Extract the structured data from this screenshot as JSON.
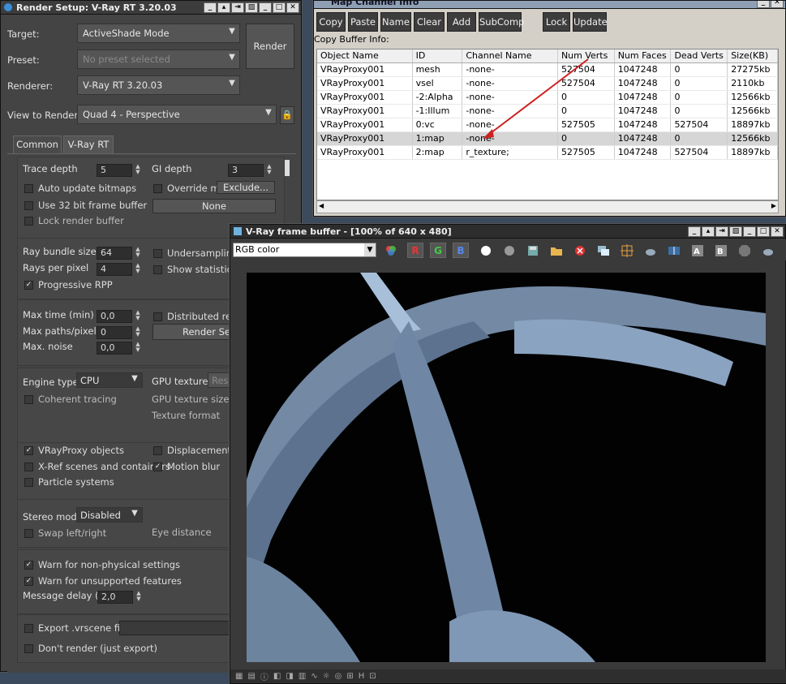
{
  "render_setup": {
    "title": "Render Setup: V-Ray RT 3.20.03",
    "target_label": "Target:",
    "target_value": "ActiveShade Mode",
    "preset_label": "Preset:",
    "preset_value": "No preset selected",
    "renderer_label": "Renderer:",
    "renderer_value": "V-Ray RT 3.20.03",
    "view_label": "View to Render:",
    "view_value": "Quad 4 - Perspective",
    "render_button": "Render",
    "tabs": [
      "Common",
      "V-Ray RT"
    ],
    "trace_depth_label": "Trace depth",
    "trace_depth": "5",
    "gi_depth_label": "GI depth",
    "gi_depth": "3",
    "auto_update": "Auto update bitmaps",
    "override_mtl": "Override mtl",
    "exclude_btn": "Exclude...",
    "use32": "Use 32 bit frame buffer",
    "none_btn": "None",
    "lock_render_buffer": "Lock render buffer",
    "ray_bundle_label": "Ray bundle size",
    "ray_bundle": "64",
    "undersampling": "Undersampling",
    "rays_per_pixel_label": "Rays per pixel",
    "rays_per_pixel": "4",
    "show_statistics": "Show statistics",
    "progressive_rpp": "Progressive RPP",
    "max_time_label": "Max time (min)",
    "max_time": "0,0",
    "distributed": "Distributed rend",
    "max_paths_label": "Max paths/pixel",
    "max_paths": "0",
    "render_serv_btn": "Render Serv",
    "max_noise_label": "Max. noise",
    "max_noise": "0,0",
    "engine_type_label": "Engine type",
    "engine_type": "CPU",
    "gpu_textures_label": "GPU textures",
    "gpu_textures_value": "Resiz",
    "coherent_tracing": "Coherent tracing",
    "gpu_texture_size": "GPU texture size",
    "texture_format": "Texture format",
    "vrayproxy": "VRayProxy objects",
    "displacement": "Displacement",
    "xref": "X-Ref scenes and containers",
    "motion_blur": "Motion blur",
    "particle_systems": "Particle systems",
    "stereo_mode_label": "Stereo mode",
    "stereo_mode": "Disabled",
    "swap_lr": "Swap left/right",
    "eye_distance": "Eye distance",
    "warn_nonphys": "Warn for non-physical settings",
    "warn_unsupported": "Warn for unsupported features",
    "msg_delay_label": "Message delay (s)",
    "msg_delay": "2,0",
    "export_vrscene": "Export .vrscene file",
    "dont_render": "Don't render (just export)"
  },
  "map_channel": {
    "title": "Map Channel Info",
    "buttons": [
      "Copy",
      "Paste",
      "Name",
      "Clear",
      "Add",
      "SubComp",
      "Lock",
      "Update"
    ],
    "copy_buffer": "Copy Buffer Info:",
    "columns": [
      "Object Name",
      "ID",
      "Channel Name",
      "Num Verts",
      "Num Faces",
      "Dead Verts",
      "Size(KB)"
    ],
    "rows": [
      [
        "VRayProxy001",
        "mesh",
        "-none-",
        "527504",
        "1047248",
        "0",
        "27275kb"
      ],
      [
        "VRayProxy001",
        "vsel",
        "-none-",
        "527504",
        "1047248",
        "0",
        "2110kb"
      ],
      [
        "VRayProxy001",
        "-2:Alpha",
        "-none-",
        "0",
        "1047248",
        "0",
        "12566kb"
      ],
      [
        "VRayProxy001",
        "-1:Illum",
        "-none-",
        "0",
        "1047248",
        "0",
        "12566kb"
      ],
      [
        "VRayProxy001",
        "0:vc",
        "-none-",
        "527505",
        "1047248",
        "527504",
        "18897kb"
      ],
      [
        "VRayProxy001",
        "1:map",
        "-none-",
        "0",
        "1047248",
        "0",
        "12566kb"
      ],
      [
        "VRayProxy001",
        "2:map",
        "r_texture;",
        "527505",
        "1047248",
        "527504",
        "18897kb"
      ]
    ]
  },
  "vfb": {
    "title": "V-Ray frame buffer - [100% of 640 x 480]",
    "channel": "RGB color",
    "r": "R",
    "g": "G",
    "b": "B"
  },
  "colors": {
    "accent_red": "#cc2222",
    "liquid": "#8ea8c8"
  }
}
